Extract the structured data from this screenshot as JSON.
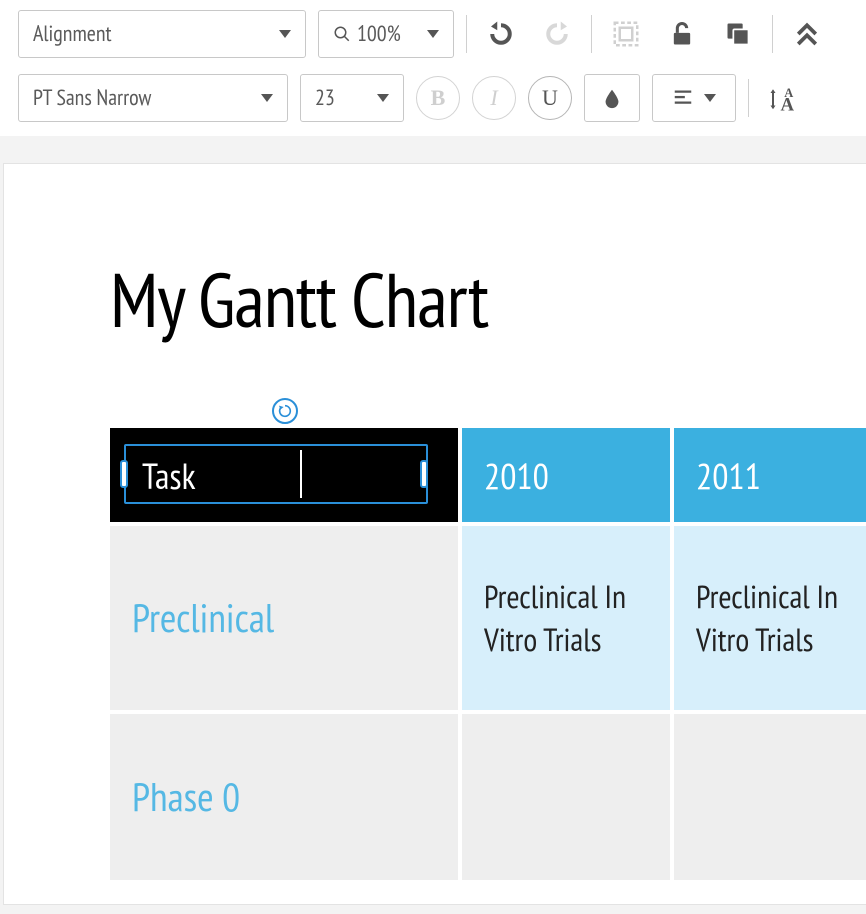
{
  "toolbar": {
    "alignment_label": "Alignment",
    "zoom_label": "100%",
    "font_label": "PT Sans Narrow",
    "size_label": "23",
    "bold_label": "B",
    "italic_label": "I",
    "underline_label": "U"
  },
  "document": {
    "title": "My Gantt Chart"
  },
  "table": {
    "headers": {
      "task": "Task",
      "y2010": "2010",
      "y2011": "2011"
    },
    "rows": [
      {
        "task": "Preclinical",
        "y2010": "Preclinical In Vitro Trials",
        "y2011": "Preclinical In Vitro Trials"
      },
      {
        "task": "Phase 0",
        "y2010": "",
        "y2011": ""
      }
    ]
  }
}
